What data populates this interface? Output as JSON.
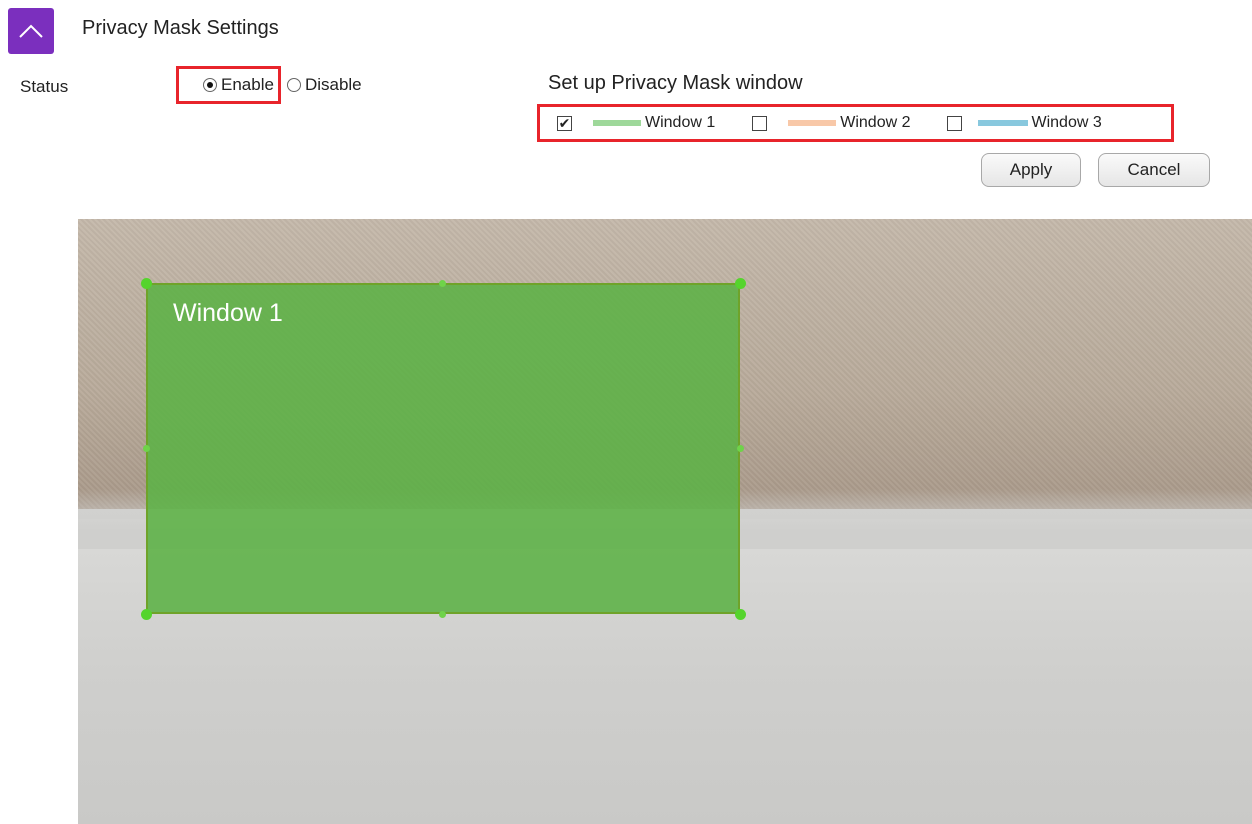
{
  "header": {
    "title": "Privacy Mask Settings",
    "collapse_icon": "chevron-up-icon"
  },
  "status": {
    "label": "Status",
    "options": [
      {
        "label": "Enable",
        "selected": true
      },
      {
        "label": "Disable",
        "selected": false
      }
    ]
  },
  "mask_setup": {
    "title": "Set up Privacy Mask window",
    "windows": [
      {
        "label": "Window 1",
        "checked": true,
        "color": "#9ed89a"
      },
      {
        "label": "Window 2",
        "checked": false,
        "color": "#f8c8a8"
      },
      {
        "label": "Window 3",
        "checked": false,
        "color": "#88c8de"
      }
    ]
  },
  "buttons": {
    "apply": "Apply",
    "cancel": "Cancel"
  },
  "preview": {
    "mask_label": "Window 1",
    "mask_color": "#5cb246"
  },
  "colors": {
    "accent": "#7b2fbe",
    "highlight_border": "#e8242b"
  }
}
